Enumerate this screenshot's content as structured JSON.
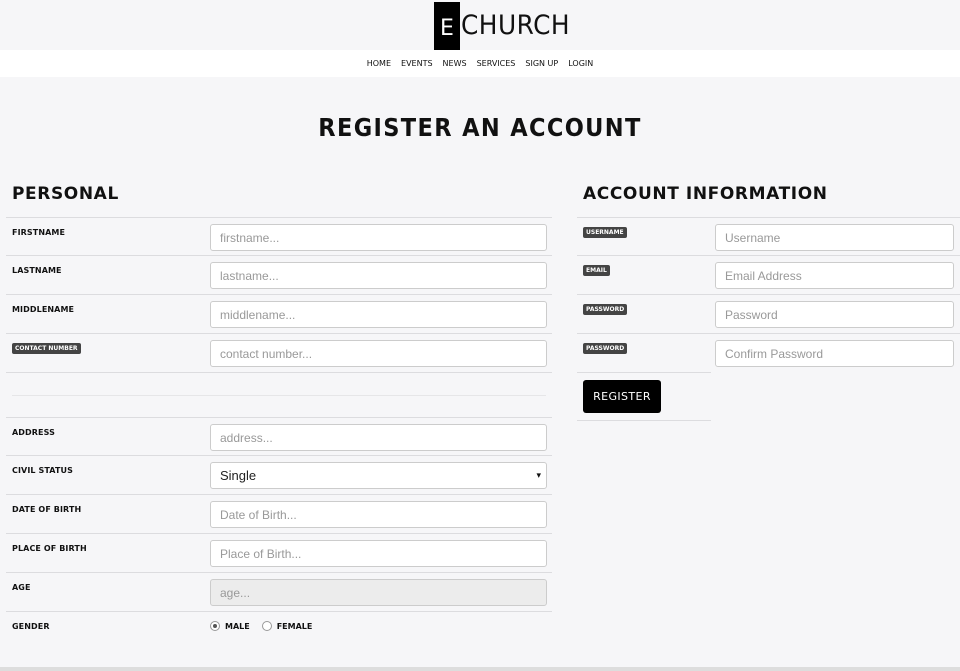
{
  "brand": {
    "logo_letter": "E",
    "logo_text": "CHURCH"
  },
  "nav": {
    "items": [
      "HOME",
      "EVENTS",
      "NEWS",
      "SERVICES",
      "SIGN UP",
      "LOGIN"
    ]
  },
  "page_title": "REGISTER AN ACCOUNT",
  "personal": {
    "title": "PERSONAL",
    "firstname": {
      "label": "FIRSTNAME",
      "placeholder": "firstname..."
    },
    "lastname": {
      "label": "LASTNAME",
      "placeholder": "lastname..."
    },
    "middlename": {
      "label": "MIDDLENAME",
      "placeholder": "middlename..."
    },
    "contact": {
      "label": "CONTACT NUMBER",
      "placeholder": "contact number..."
    },
    "address": {
      "label": "ADDRESS",
      "placeholder": "address..."
    },
    "civil_status": {
      "label": "CIVIL STATUS",
      "value": "Single",
      "caret": "▾"
    },
    "dob": {
      "label": "DATE OF BIRTH",
      "placeholder": "Date of Birth..."
    },
    "pob": {
      "label": "PLACE OF BIRTH",
      "placeholder": "Place of Birth..."
    },
    "age": {
      "label": "AGE",
      "placeholder": "age..."
    },
    "gender": {
      "label": "GENDER",
      "options": [
        "MALE",
        "FEMALE"
      ],
      "selected": "MALE"
    }
  },
  "account": {
    "title": "ACCOUNT INFORMATION",
    "username": {
      "label": "USERNAME",
      "placeholder": "Username"
    },
    "email": {
      "label": "EMAIL",
      "placeholder": "Email Address"
    },
    "password": {
      "label": "PASSWORD",
      "placeholder": "Password"
    },
    "confirm": {
      "label": "PASSWORD",
      "placeholder": "Confirm Password"
    },
    "register_label": "REGISTER"
  }
}
